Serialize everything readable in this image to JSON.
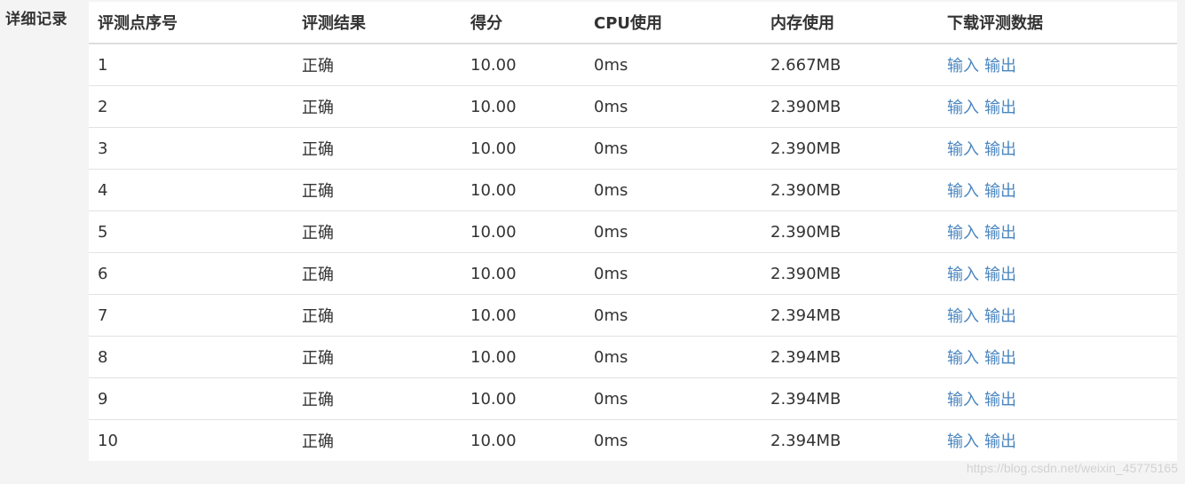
{
  "section_label": "详细记录",
  "table": {
    "headers": [
      "评测点序号",
      "评测结果",
      "得分",
      "CPU使用",
      "内存使用",
      "下载评测数据"
    ],
    "rows": [
      {
        "index": "1",
        "result": "正确",
        "score": "10.00",
        "cpu": "0ms",
        "memory": "2.667MB",
        "input_link": "输入",
        "output_link": "输出"
      },
      {
        "index": "2",
        "result": "正确",
        "score": "10.00",
        "cpu": "0ms",
        "memory": "2.390MB",
        "input_link": "输入",
        "output_link": "输出"
      },
      {
        "index": "3",
        "result": "正确",
        "score": "10.00",
        "cpu": "0ms",
        "memory": "2.390MB",
        "input_link": "输入",
        "output_link": "输出"
      },
      {
        "index": "4",
        "result": "正确",
        "score": "10.00",
        "cpu": "0ms",
        "memory": "2.390MB",
        "input_link": "输入",
        "output_link": "输出"
      },
      {
        "index": "5",
        "result": "正确",
        "score": "10.00",
        "cpu": "0ms",
        "memory": "2.390MB",
        "input_link": "输入",
        "output_link": "输出"
      },
      {
        "index": "6",
        "result": "正确",
        "score": "10.00",
        "cpu": "0ms",
        "memory": "2.390MB",
        "input_link": "输入",
        "output_link": "输出"
      },
      {
        "index": "7",
        "result": "正确",
        "score": "10.00",
        "cpu": "0ms",
        "memory": "2.394MB",
        "input_link": "输入",
        "output_link": "输出"
      },
      {
        "index": "8",
        "result": "正确",
        "score": "10.00",
        "cpu": "0ms",
        "memory": "2.394MB",
        "input_link": "输入",
        "output_link": "输出"
      },
      {
        "index": "9",
        "result": "正确",
        "score": "10.00",
        "cpu": "0ms",
        "memory": "2.394MB",
        "input_link": "输入",
        "output_link": "输出"
      },
      {
        "index": "10",
        "result": "正确",
        "score": "10.00",
        "cpu": "0ms",
        "memory": "2.394MB",
        "input_link": "输入",
        "output_link": "输出"
      }
    ]
  },
  "watermark": "https://blog.csdn.net/weixin_45775165",
  "colors": {
    "link": "#4a86c0",
    "text": "#333333",
    "background": "#f4f4f4",
    "panel": "#ffffff"
  }
}
